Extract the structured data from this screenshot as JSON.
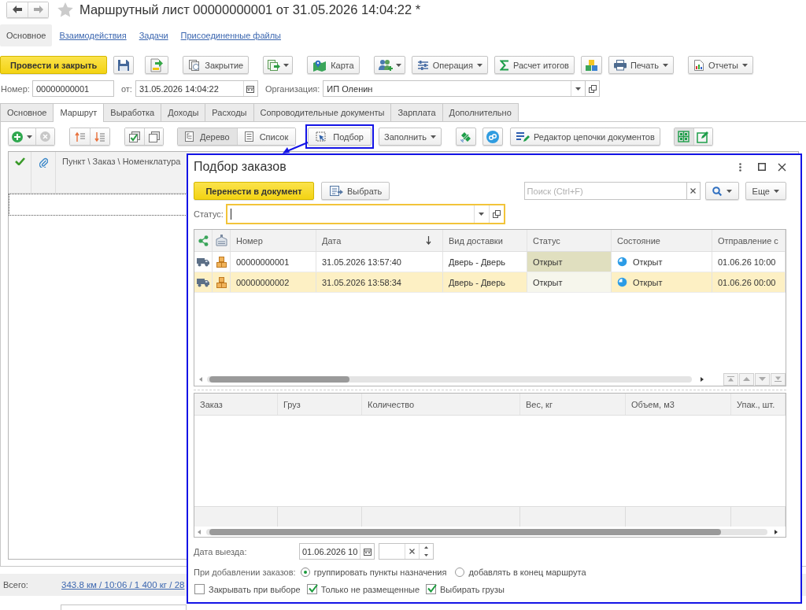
{
  "window": {
    "title": "Маршрутный лист 00000000001 от 31.05.2026 14:04:22 *"
  },
  "sections": [
    {
      "label": "Основное",
      "selected": true
    },
    {
      "label": "Взаимодействия",
      "selected": false
    },
    {
      "label": "Задачи",
      "selected": false
    },
    {
      "label": "Присоединенные файлы",
      "selected": false
    }
  ],
  "commands": {
    "post_and_close": "Провести и закрыть",
    "closing": "Закрытие",
    "map": "Карта",
    "operation": "Операция",
    "totals": "Расчет итогов",
    "print": "Печать",
    "reports": "Отчеты"
  },
  "header_fields": {
    "number": {
      "label": "Номер:",
      "value": "00000000001"
    },
    "date": {
      "label": "от:",
      "value": "31.05.2026 14:04:22"
    },
    "organization": {
      "label": "Организация:",
      "value": "ИП Оленин"
    }
  },
  "tabs": [
    {
      "label": "Основное",
      "selected": false
    },
    {
      "label": "Маршрут",
      "selected": true
    },
    {
      "label": "Выработка",
      "selected": false
    },
    {
      "label": "Доходы",
      "selected": false
    },
    {
      "label": "Расходы",
      "selected": false
    },
    {
      "label": "Сопроводительные документы",
      "selected": false
    },
    {
      "label": "Зарплата",
      "selected": false
    },
    {
      "label": "Дополнительно",
      "selected": false
    }
  ],
  "route": {
    "view_mode": [
      {
        "kind": "tree",
        "label": "Дерево",
        "selected": true
      },
      {
        "kind": "list",
        "label": "Список",
        "selected": false
      }
    ],
    "pick_button": "Подбор",
    "fill_button": "Заполнить",
    "chain_editor_button": "Редактор цепочки документов",
    "layout_toggle": [
      {
        "kind": "grid",
        "selected": true
      },
      {
        "kind": "form",
        "selected": false
      }
    ],
    "columns": [
      "Пункт \\ Заказ \\ Номенклатура"
    ]
  },
  "totals": {
    "label": "Всего:",
    "value": "343.8 км / 10:06 / 1 400 кг / 28"
  },
  "dialog": {
    "title": "Подбор заказов",
    "transfer_button": "Перенести в документ",
    "select_button": "Выбрать",
    "search": {
      "placeholder": "Поиск (Ctrl+F)"
    },
    "more_button": "Еще",
    "status_filter": {
      "label": "Статус:",
      "focused": true
    },
    "orders": {
      "columns": [
        {
          "label": "Номер",
          "sorted": false
        },
        {
          "label": "Дата",
          "sorted": true
        },
        {
          "label": "Вид доставки",
          "sorted": false
        },
        {
          "label": "Статус",
          "sorted": false
        },
        {
          "label": "Состояние",
          "sorted": false
        },
        {
          "label": "Отправление с",
          "sorted": false
        }
      ],
      "rows": [
        {
          "number": "00000000001",
          "date": "31.05.2026 13:57:40",
          "delivery": "Дверь - Дверь",
          "status": {
            "label": "Открыт",
            "color": "#e0dfbf"
          },
          "state": "Открыт",
          "departure": "01.06.26 10:00",
          "selected": false
        },
        {
          "number": "00000000002",
          "date": "31.05.2026 13:58:34",
          "delivery": "Дверь - Дверь",
          "status": {
            "label": "Открыт",
            "color": "#f6f6ec"
          },
          "state": "Открыт",
          "departure": "01.06.26 00:00",
          "selected": true
        }
      ]
    },
    "cargo": {
      "columns": [
        "Заказ",
        "Груз",
        "Количество",
        "Вес, кг",
        "Объем, м3",
        "Упак., шт."
      ]
    },
    "departure_date": {
      "label": "Дата выезда:",
      "value": "01.06.2026 10"
    },
    "add_mode": {
      "label": "При добавлении заказов:",
      "options": [
        {
          "label": "группировать пункты назначения",
          "selected": true
        },
        {
          "label": "добавлять в конец маршрута",
          "selected": false
        }
      ]
    },
    "options": [
      {
        "label": "Закрывать при выборе",
        "checked": false
      },
      {
        "label": "Только не размещенные",
        "checked": true
      },
      {
        "label": "Выбирать грузы",
        "checked": true
      }
    ]
  }
}
